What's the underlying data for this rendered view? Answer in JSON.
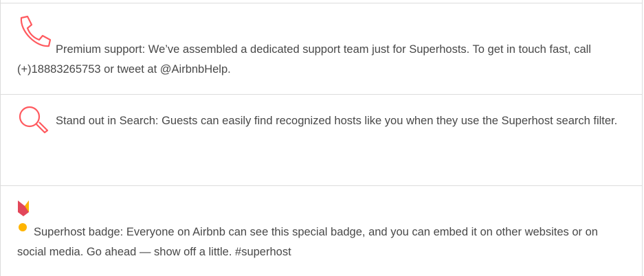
{
  "benefits": [
    {
      "icon": "phone-icon",
      "text": "Premium support: We’ve assembled a dedicated support team just for Superhosts. To get in touch fast, call (+)18883265753 or tweet at @AirbnbHelp."
    },
    {
      "icon": "search-icon",
      "text": "Stand out in Search: Guests can easily find recognized hosts like you when they use the Superhost search filter."
    },
    {
      "icon": "superhost-badge-icon",
      "text": "Superhost badge: Everyone on Airbnb can see this special badge, and you can embed it on other websites or on social media. Go ahead — show off a little. #superhost"
    }
  ],
  "colors": {
    "accent": "#ff5a5f",
    "badge_yellow": "#ffb400",
    "text": "#484848",
    "divider": "#dcdcdc"
  }
}
